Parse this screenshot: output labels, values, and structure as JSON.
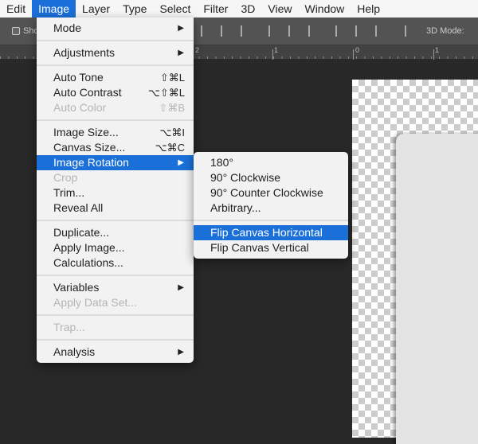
{
  "menubar": [
    "Edit",
    "Image",
    "Layer",
    "Type",
    "Select",
    "Filter",
    "3D",
    "View",
    "Window",
    "Help"
  ],
  "toolbar": {
    "show_label": "Sho",
    "mode_label": "3D Mode:"
  },
  "ruler": [
    "2",
    "1",
    "0",
    "1"
  ],
  "image_menu": [
    {
      "label": "Mode",
      "submenu": true
    },
    {
      "sep": true
    },
    {
      "label": "Adjustments",
      "submenu": true
    },
    {
      "sep": true
    },
    {
      "label": "Auto Tone",
      "shortcut": "⇧⌘L"
    },
    {
      "label": "Auto Contrast",
      "shortcut": "⌥⇧⌘L"
    },
    {
      "label": "Auto Color",
      "shortcut": "⇧⌘B",
      "disabled": true
    },
    {
      "sep": true
    },
    {
      "label": "Image Size...",
      "shortcut": "⌥⌘I"
    },
    {
      "label": "Canvas Size...",
      "shortcut": "⌥⌘C"
    },
    {
      "label": "Image Rotation",
      "submenu": true,
      "highlighted": true
    },
    {
      "label": "Crop",
      "disabled": true
    },
    {
      "label": "Trim..."
    },
    {
      "label": "Reveal All"
    },
    {
      "sep": true
    },
    {
      "label": "Duplicate..."
    },
    {
      "label": "Apply Image..."
    },
    {
      "label": "Calculations..."
    },
    {
      "sep": true
    },
    {
      "label": "Variables",
      "submenu": true
    },
    {
      "label": "Apply Data Set...",
      "disabled": true
    },
    {
      "sep": true
    },
    {
      "label": "Trap...",
      "disabled": true
    },
    {
      "sep": true
    },
    {
      "label": "Analysis",
      "submenu": true
    }
  ],
  "rotation_submenu": [
    {
      "label": "180°"
    },
    {
      "label": "90° Clockwise"
    },
    {
      "label": "90° Counter Clockwise"
    },
    {
      "label": "Arbitrary..."
    },
    {
      "sep": true
    },
    {
      "label": "Flip Canvas Horizontal",
      "highlighted": true
    },
    {
      "label": "Flip Canvas Vertical"
    }
  ],
  "colors": {
    "highlight": "#1a6fd8",
    "canvas_bg": "#282828",
    "toolbar": "#535353"
  }
}
